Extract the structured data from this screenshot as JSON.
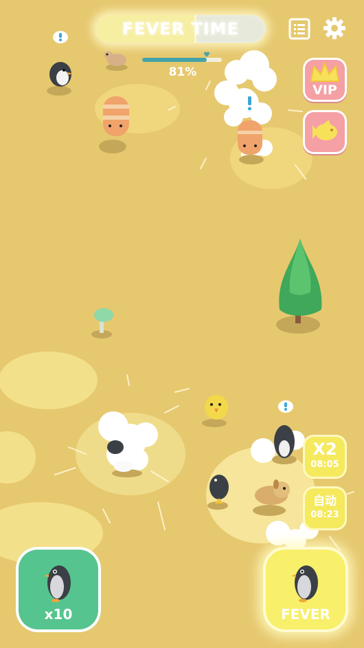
{
  "hud": {
    "fever_title": "FEVER TIME",
    "fever_level": 0.58,
    "progress": 0.81,
    "progress_label": "81%"
  },
  "side_buttons": {
    "vip_label": "VIP",
    "fish_icon": "goldfish-icon",
    "x2": {
      "label": "X2",
      "timer": "08:05"
    },
    "auto": {
      "label": "自动",
      "timer": "08:23"
    }
  },
  "bottom_buttons": {
    "penguin": {
      "label": "x10",
      "icon": "penguin-icon"
    },
    "fever": {
      "label": "FEVER",
      "icon": "penguin-icon"
    }
  },
  "colors": {
    "ground": "#e6c86f",
    "progress": "#46a2a8",
    "green_button": "#55c48e",
    "yellow_button": "#f8ef6a",
    "pink_button": "#f4a0a4"
  }
}
